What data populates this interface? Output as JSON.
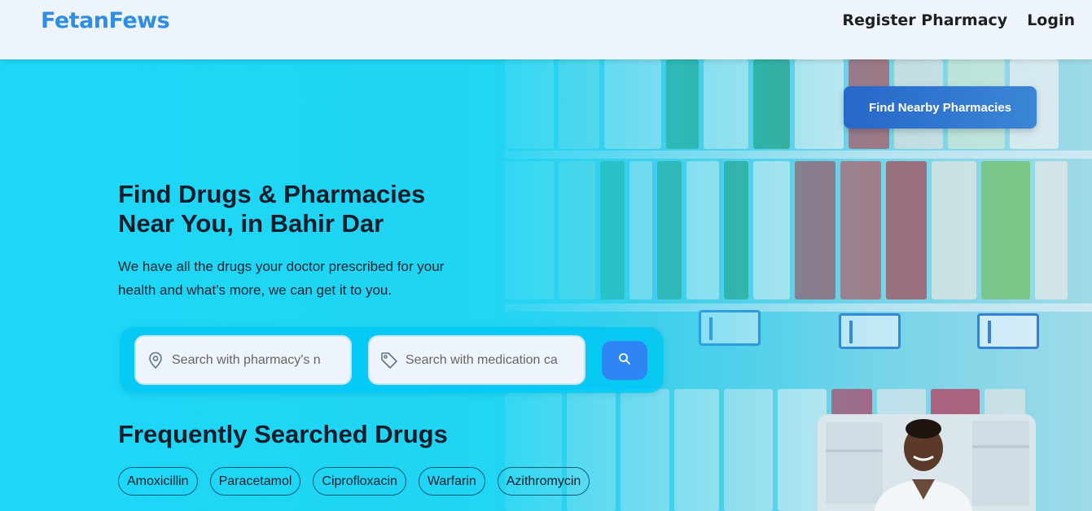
{
  "brand": {
    "name": "FetanFews",
    "color": "#2f8de4"
  },
  "nav": {
    "register_label": "Register Pharmacy",
    "login_label": "Login"
  },
  "hero": {
    "cta_label": "Find Nearby Pharmacies",
    "headline_line1": "Find Drugs & Pharmacies",
    "headline_line2": "Near You, in Bahir Dar",
    "subtitle_line1": "We have all the drugs your doctor prescribed for your",
    "subtitle_line2": "health and what’s more, we can get it to you."
  },
  "search": {
    "pharmacy_placeholder": "Search with pharmacy's n",
    "medication_placeholder": "Search with medication ca",
    "pharmacy_icon": "location-pin-icon",
    "medication_icon": "tag-icon",
    "submit_icon": "search-icon"
  },
  "frequent": {
    "title": "Frequently Searched Drugs",
    "drugs": [
      "Amoxicillin",
      "Paracetamol",
      "Ciprofloxacin",
      "Warfarin",
      "Azithromycin"
    ]
  },
  "colors": {
    "accent": "#2e86f5",
    "hero_bg": "#22d3f2",
    "cta_bg": "#2667c9"
  }
}
